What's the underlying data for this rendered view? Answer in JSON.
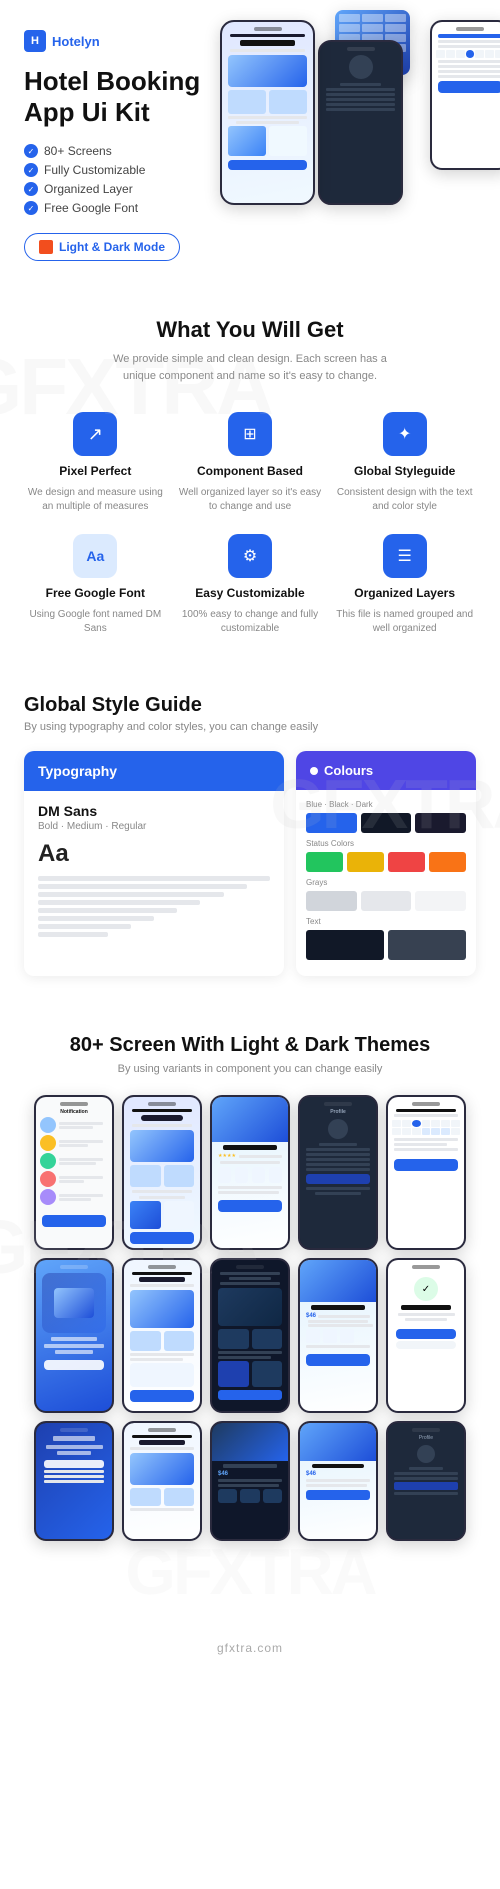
{
  "brand": {
    "name": "Hotelyn",
    "icon": "H"
  },
  "hero": {
    "title": "Hotel Booking App Ui Kit",
    "features": [
      "80+ Screens",
      "Fully Customizable",
      "Organized Layer",
      "Free Google Font"
    ],
    "cta_label": "Light & Dark Mode"
  },
  "what_section": {
    "title": "What You Will Get",
    "subtitle": "We provide simple and clean design. Each screen has a unique component and name so it's easy to change.",
    "features": [
      {
        "icon": "↗",
        "title": "Pixel Perfect",
        "desc": "We design and measure using an multiple of measures"
      },
      {
        "icon": "⊞",
        "title": "Component Based",
        "desc": "Well organized layer so it's easy to change and use"
      },
      {
        "icon": "✦",
        "title": "Global Styleguide",
        "desc": "Consistent design with the text and color style"
      },
      {
        "icon": "Aa",
        "title": "Free Google Font",
        "desc": "Using Google font named DM Sans"
      },
      {
        "icon": "⚙",
        "title": "Easy Customizable",
        "desc": "100% easy to change and fully customizable"
      },
      {
        "icon": "☰",
        "title": "Organized Layers",
        "desc": "This file is named grouped and well organized"
      }
    ]
  },
  "style_guide": {
    "title": "Global Style Guide",
    "subtitle": "By using typography and color styles, you can change easily",
    "typography": {
      "header": "Typography",
      "font_name": "DM Sans",
      "font_weights": "Bold · Medium · Regular",
      "sample": "Aa"
    },
    "colours": {
      "header": "Colours",
      "groups": [
        {
          "label": "Blue",
          "swatches": [
            "#2563eb",
            "#000000",
            "#1a1a2e"
          ]
        },
        {
          "label": "",
          "swatches": [
            "#22c55e",
            "#eab308",
            "#ef4444",
            "#f97316"
          ]
        },
        {
          "label": "",
          "swatches": [
            "#d1d5db",
            "#e5e7eb",
            "#f3f4f6"
          ]
        },
        {
          "label": "",
          "swatches": [
            "#111827",
            "#374151"
          ]
        }
      ]
    }
  },
  "screens_section": {
    "title": "80+ Screen With Light & Dark Themes",
    "subtitle": "By using variants in component you can change easily"
  },
  "watermarks": {
    "gfxtra": "GFXTRA",
    "gfxtra_bottom": "GFXTRA",
    "site": "gfxtra.com"
  }
}
